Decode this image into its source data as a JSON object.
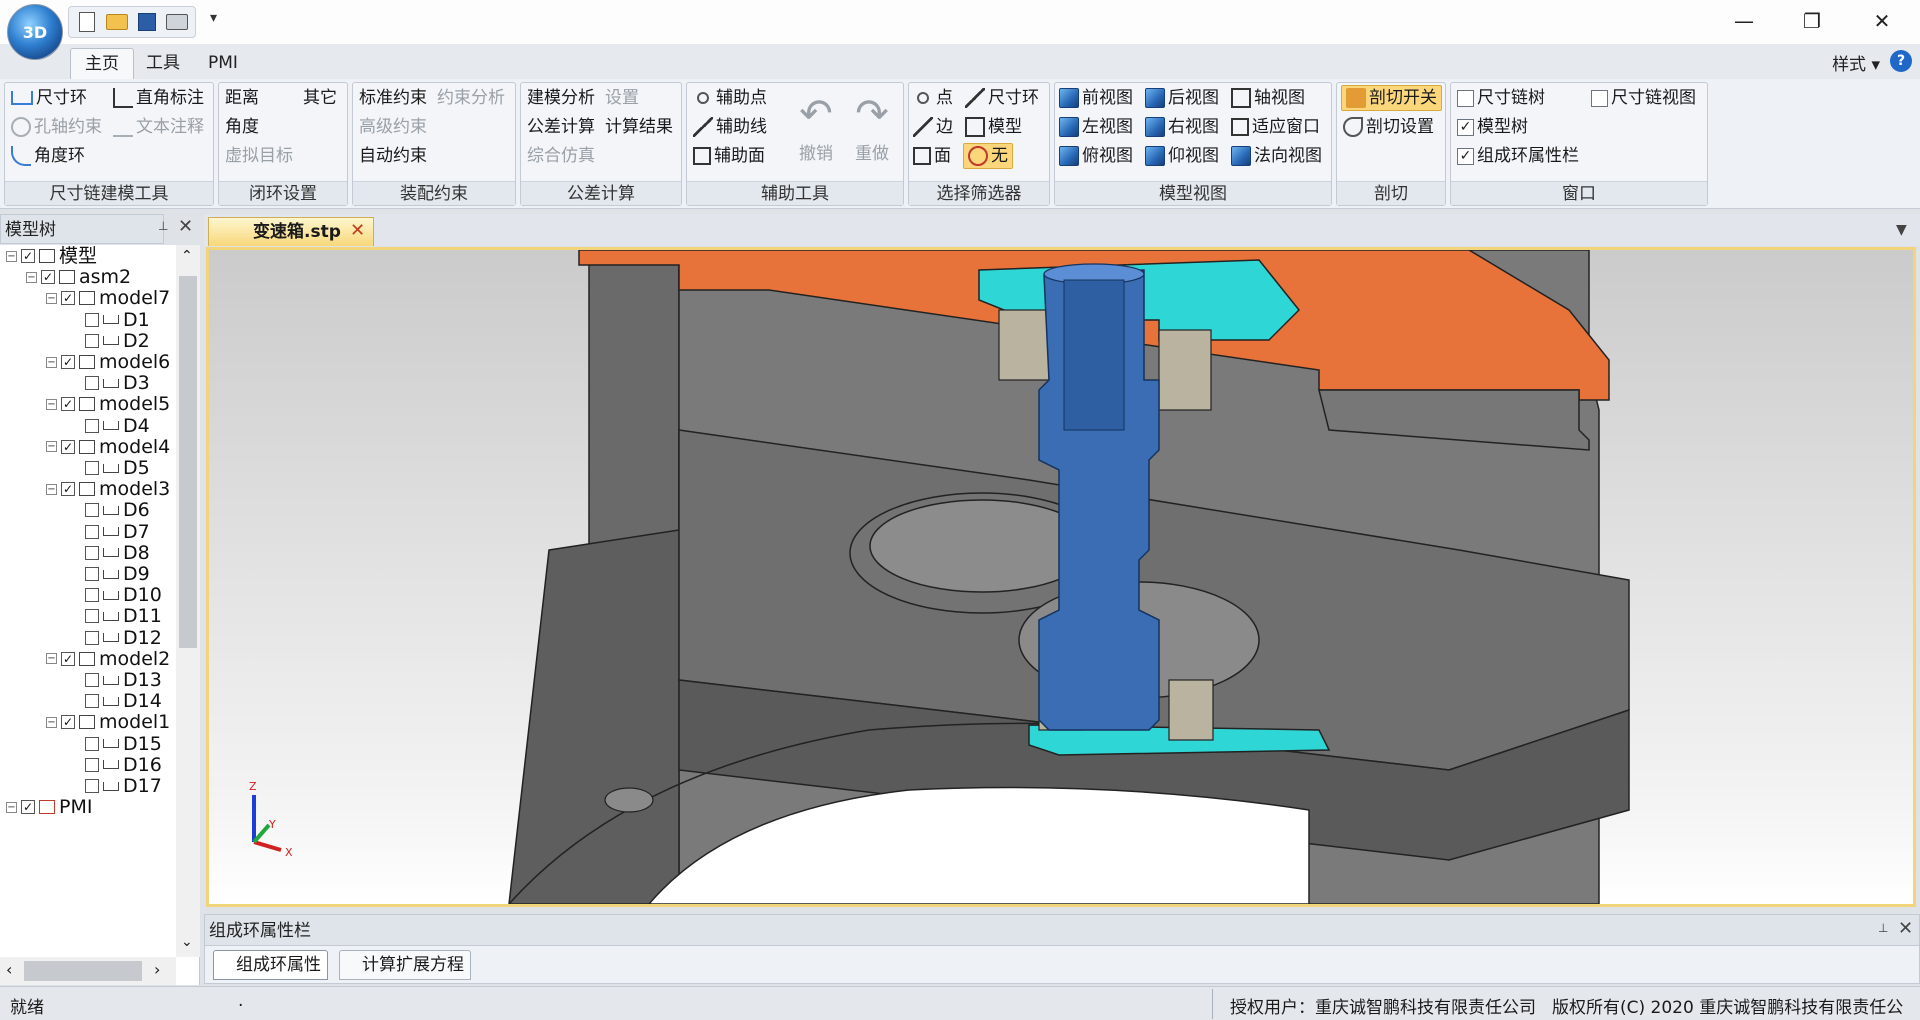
{
  "app": {
    "logo_text": "3D"
  },
  "titlebar": {
    "more_glyph": "▾",
    "minimize": "—",
    "restore": "❐",
    "close": "✕"
  },
  "ribbon_tabs": [
    {
      "label": "主页",
      "active": true
    },
    {
      "label": "工具",
      "active": false
    },
    {
      "label": "PMI",
      "active": false
    }
  ],
  "style_menu": "样式 ▾",
  "help": "?",
  "groups": {
    "dimchain": {
      "title": "尺寸链建模工具",
      "dim_loop": "尺寸环",
      "right_angle": "直角标注",
      "hole_axis": "孔轴约束",
      "text_note": "文本注释",
      "angle_loop": "角度环"
    },
    "closure": {
      "title": "闭环设置",
      "distance": "距离",
      "other": "其它",
      "angle": "角度",
      "virtual": "虚拟目标"
    },
    "assembly": {
      "title": "装配约束",
      "standard": "标准约束",
      "analysis": "约束分析",
      "advanced": "高级约束",
      "auto": "自动约束"
    },
    "tolerance": {
      "title": "公差计算",
      "model_analysis": "建模分析",
      "settings": "设置",
      "calc": "公差计算",
      "result": "计算结果",
      "simulation": "综合仿真"
    },
    "aux": {
      "title": "辅助工具",
      "point": "辅助点",
      "line": "辅助线",
      "face": "辅助面",
      "undo": "撤销",
      "redo": "重做"
    },
    "filter": {
      "title": "选择筛选器",
      "point": "点",
      "dim_loop": "尺寸环",
      "edge": "边",
      "model": "模型",
      "face": "面",
      "none": "无"
    },
    "views": {
      "title": "模型视图",
      "front": "前视图",
      "back": "后视图",
      "axis": "轴视图",
      "left": "左视图",
      "right": "右视图",
      "fit": "适应窗口",
      "top": "俯视图",
      "bottom": "仰视图",
      "normal": "法向视图"
    },
    "section": {
      "title": "剖切",
      "toggle": "剖切开关",
      "settings": "剖切设置"
    },
    "window": {
      "title": "窗口",
      "dim_tree": "尺寸链树",
      "dim_view": "尺寸链视图",
      "model_tree": "模型树",
      "prop_bar": "组成环属性栏",
      "dim_tree_checked": false,
      "dim_view_checked": false,
      "model_tree_checked": true,
      "prop_bar_checked": true
    }
  },
  "model_tree": {
    "title": "模型树",
    "pin": "📌",
    "close": "✕",
    "nodes": [
      {
        "label": "模型",
        "level": 0,
        "type": "root"
      },
      {
        "label": "asm2",
        "level": 1,
        "type": "asm"
      },
      {
        "label": "model7",
        "level": 2,
        "type": "part"
      },
      {
        "label": "D1",
        "level": 3,
        "type": "dim"
      },
      {
        "label": "D2",
        "level": 3,
        "type": "dim"
      },
      {
        "label": "model6",
        "level": 2,
        "type": "part"
      },
      {
        "label": "D3",
        "level": 3,
        "type": "dim"
      },
      {
        "label": "model5",
        "level": 2,
        "type": "part"
      },
      {
        "label": "D4",
        "level": 3,
        "type": "dim"
      },
      {
        "label": "model4",
        "level": 2,
        "type": "part"
      },
      {
        "label": "D5",
        "level": 3,
        "type": "dim"
      },
      {
        "label": "model3",
        "level": 2,
        "type": "part"
      },
      {
        "label": "D6",
        "level": 3,
        "type": "dim"
      },
      {
        "label": "D7",
        "level": 3,
        "type": "dim"
      },
      {
        "label": "D8",
        "level": 3,
        "type": "dim"
      },
      {
        "label": "D9",
        "level": 3,
        "type": "dim"
      },
      {
        "label": "D10",
        "level": 3,
        "type": "dim"
      },
      {
        "label": "D11",
        "level": 3,
        "type": "dim"
      },
      {
        "label": "D12",
        "level": 3,
        "type": "dim"
      },
      {
        "label": "model2",
        "level": 2,
        "type": "part"
      },
      {
        "label": "D13",
        "level": 3,
        "type": "dim"
      },
      {
        "label": "D14",
        "level": 3,
        "type": "dim"
      },
      {
        "label": "model1",
        "level": 2,
        "type": "part"
      },
      {
        "label": "D15",
        "level": 3,
        "type": "dim"
      },
      {
        "label": "D16",
        "level": 3,
        "type": "dim"
      },
      {
        "label": "D17",
        "level": 3,
        "type": "dim"
      },
      {
        "label": "PMI",
        "level": 0,
        "type": "pmi"
      }
    ]
  },
  "document": {
    "tab": "变速箱.stp",
    "close": "✕",
    "menu": "▼"
  },
  "axes": {
    "z": "Z",
    "y": "Y",
    "x": "X"
  },
  "properties": {
    "title": "组成环属性栏",
    "tabs": [
      "组成环属性",
      "计算扩展方程"
    ]
  },
  "status": {
    "ready": "就绪",
    "dot": ".",
    "user": "授权用户：重庆诚智鹏科技有限责任公司",
    "copyright": "版权所有(C) 2020 重庆诚智鹏科技有限责任公司"
  },
  "colors": {
    "orange": "#e8733a",
    "cyan": "#2fd6d6",
    "blue": "#3a6db3",
    "gray": "#6e6e6e",
    "tab_gold": "#f7d87a"
  }
}
